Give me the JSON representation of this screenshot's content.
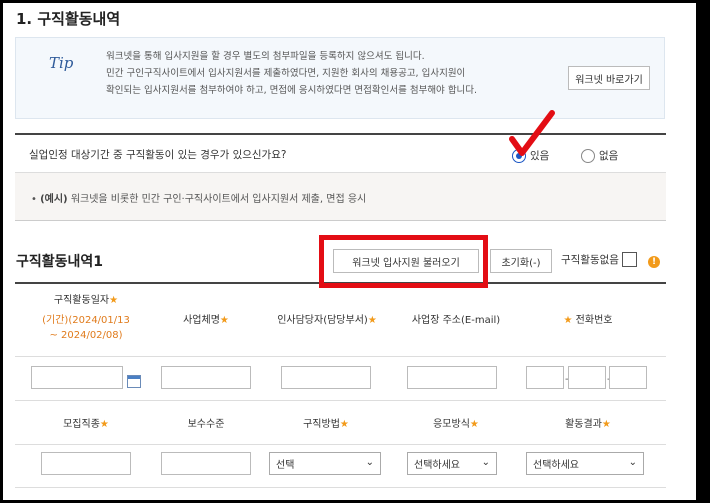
{
  "section": {
    "title": "1. 구직활동내역"
  },
  "tip": {
    "label": "Tip",
    "lines": [
      "워크넷을 통해 입사지원을 할 경우 별도의 첨부파일을 등록하지 않으셔도 됩니다.",
      "민간 구인구직사이트에서 입사지원서를 제출하였다면, 지원한 회사의 채용공고, 입사지원이",
      "확인되는 입사지원서를 첨부하여야 하고, 면접에 응시하였다면 면접확인서를 첨부해야 합니다."
    ],
    "worknet_button": "워크넷 바로가기"
  },
  "question": {
    "text": "실업인정 대상기간 중 구직활동이 있는 경우가 있으신가요?",
    "options": [
      {
        "label": "있음",
        "selected": true
      },
      {
        "label": "없음",
        "selected": false
      }
    ]
  },
  "example": {
    "prefix": "(예시)",
    "text": "워크넷을 비롯한 민간 구인·구직사이트에서 입사지원서 제출, 면접 응시"
  },
  "activity": {
    "title": "구직활동내역1",
    "import_button": "워크넷 입사지원 불러오기",
    "reset_button": "초기화(-)",
    "no_activity_label": "구직활동없음",
    "no_activity_checked": false,
    "info_icon": "!"
  },
  "table": {
    "headers_row1": {
      "date": "구직활동일자",
      "period_line1": "(기간)(2024/01/13",
      "period_line2": "~ 2024/02/08)",
      "company": "사업체명",
      "manager": "인사담당자(담당부서)",
      "address": "사업장 주소(E-mail)",
      "phone": "전화번호"
    },
    "headers_row2": {
      "job": "모집직종",
      "salary": "보수수준",
      "method": "구직방법",
      "apply": "응모방식",
      "result": "활동결과"
    },
    "selects": {
      "method": "선택",
      "apply": "선택하세요",
      "result": "선택하세요"
    },
    "required_mark": "★"
  },
  "annotations": {
    "highlight_color": "#e30d14"
  }
}
